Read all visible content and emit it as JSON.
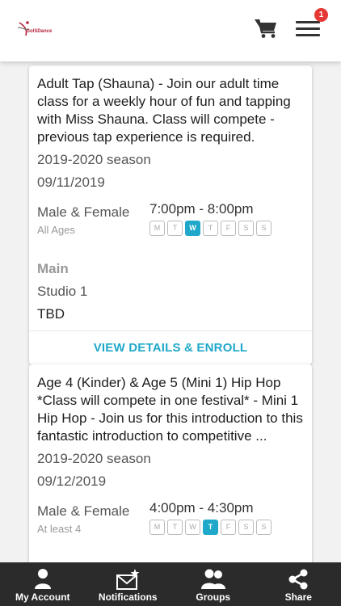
{
  "header": {
    "logo_text": "SolSDance",
    "cart_icon": "shopping-cart-icon",
    "menu_icon": "hamburger-menu-icon",
    "notification_count": "1"
  },
  "classes": [
    {
      "title": "Adult Tap (Shauna) - Join our adult time class for a weekly hour of fun and tapping with Miss Shauna. Class will compete - previous tap experience is required.",
      "season": "2019-2020 season",
      "date": "09/11/2019",
      "gender": "Male & Female",
      "ages": "All Ages",
      "time": "7:00pm - 8:00pm",
      "days": [
        "M",
        "T",
        "W",
        "T",
        "F",
        "S",
        "S"
      ],
      "active_day_index": 2,
      "location": "Main",
      "room": "Studio 1",
      "teacher": "TBD",
      "cta": "VIEW DETAILS & ENROLL"
    },
    {
      "title": "Age 4 (Kinder) & Age 5 (Mini 1) Hip Hop *Class will compete in one festival* - Mini 1 Hip Hop - Join us for this introduction to this fantastic introduction to competitive ...",
      "season": "2019-2020 season",
      "date": "09/12/2019",
      "gender": "Male & Female",
      "ages": "At least 4",
      "time": "4:00pm - 4:30pm",
      "days": [
        "M",
        "T",
        "W",
        "T",
        "F",
        "S",
        "S"
      ],
      "active_day_index": 3
    }
  ],
  "bottom_nav": [
    {
      "label": "My Account",
      "icon": "person-icon"
    },
    {
      "label": "Notifications",
      "icon": "envelope-star-icon"
    },
    {
      "label": "Groups",
      "icon": "group-icon"
    },
    {
      "label": "Share",
      "icon": "share-icon"
    }
  ],
  "colors": {
    "accent": "#1fa8c9",
    "badge": "#e53935",
    "nav_bg": "#2b2b2b"
  }
}
